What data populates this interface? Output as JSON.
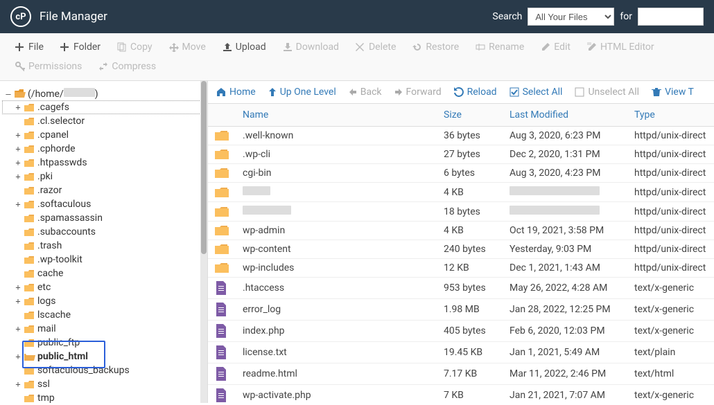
{
  "header": {
    "app_title": "File Manager",
    "search_label": "Search",
    "search_scope_selected": "All Your Files",
    "for_label": "for"
  },
  "toolbar": [
    {
      "id": "file",
      "label": "File",
      "icon": "plus",
      "disabled": false
    },
    {
      "id": "folder",
      "label": "Folder",
      "icon": "plus",
      "disabled": false
    },
    {
      "id": "copy",
      "label": "Copy",
      "icon": "copy",
      "disabled": true
    },
    {
      "id": "move",
      "label": "Move",
      "icon": "move",
      "disabled": true
    },
    {
      "id": "upload",
      "label": "Upload",
      "icon": "upload",
      "disabled": false
    },
    {
      "id": "download",
      "label": "Download",
      "icon": "download",
      "disabled": true
    },
    {
      "id": "delete",
      "label": "Delete",
      "icon": "x",
      "disabled": true
    },
    {
      "id": "restore",
      "label": "Restore",
      "icon": "restore",
      "disabled": true
    },
    {
      "id": "rename",
      "label": "Rename",
      "icon": "rename",
      "disabled": true
    },
    {
      "id": "edit",
      "label": "Edit",
      "icon": "pencil",
      "disabled": true
    },
    {
      "id": "html-editor",
      "label": "HTML Editor",
      "icon": "html",
      "disabled": true
    },
    {
      "id": "permissions",
      "label": "Permissions",
      "icon": "key",
      "disabled": true
    },
    {
      "id": "compress",
      "label": "Compress",
      "icon": "compress",
      "disabled": true
    }
  ],
  "tree": {
    "root_label": "(/home/",
    "root_label_suffix": ")",
    "items": [
      {
        "label": ".cagefs",
        "expandable": true,
        "depth": 1,
        "dotted": true
      },
      {
        "label": ".cl.selector",
        "expandable": false,
        "depth": 1
      },
      {
        "label": ".cpanel",
        "expandable": true,
        "depth": 1
      },
      {
        "label": ".cphorde",
        "expandable": true,
        "depth": 1
      },
      {
        "label": ".htpasswds",
        "expandable": true,
        "depth": 1
      },
      {
        "label": ".pki",
        "expandable": true,
        "depth": 1
      },
      {
        "label": ".razor",
        "expandable": false,
        "depth": 1
      },
      {
        "label": ".softaculous",
        "expandable": true,
        "depth": 1
      },
      {
        "label": ".spamassassin",
        "expandable": false,
        "depth": 1
      },
      {
        "label": ".subaccounts",
        "expandable": false,
        "depth": 1
      },
      {
        "label": ".trash",
        "expandable": false,
        "depth": 1
      },
      {
        "label": ".wp-toolkit",
        "expandable": false,
        "depth": 1
      },
      {
        "label": "cache",
        "expandable": false,
        "depth": 1
      },
      {
        "label": "etc",
        "expandable": true,
        "depth": 1
      },
      {
        "label": "logs",
        "expandable": true,
        "depth": 1
      },
      {
        "label": "lscache",
        "expandable": false,
        "depth": 1
      },
      {
        "label": "mail",
        "expandable": true,
        "depth": 1
      },
      {
        "label": "public_ftp",
        "expandable": false,
        "depth": 1
      },
      {
        "label": "public_html",
        "expandable": true,
        "depth": 1,
        "selected": true,
        "open": true
      },
      {
        "label": "softaculous_backups",
        "expandable": false,
        "depth": 1
      },
      {
        "label": "ssl",
        "expandable": true,
        "depth": 1
      },
      {
        "label": "tmp",
        "expandable": false,
        "depth": 1
      }
    ]
  },
  "content_toolbar": [
    {
      "id": "home",
      "label": "Home",
      "icon": "home",
      "style": "blue"
    },
    {
      "id": "up",
      "label": "Up One Level",
      "icon": "up",
      "style": "blue"
    },
    {
      "id": "back",
      "label": "Back",
      "icon": "left",
      "style": "gray"
    },
    {
      "id": "forward",
      "label": "Forward",
      "icon": "right",
      "style": "gray"
    },
    {
      "id": "reload",
      "label": "Reload",
      "icon": "reload",
      "style": "blue"
    },
    {
      "id": "select-all",
      "label": "Select All",
      "icon": "check",
      "style": "blue"
    },
    {
      "id": "unselect-all",
      "label": "Unselect All",
      "icon": "uncheck",
      "style": "gray"
    },
    {
      "id": "view-trash",
      "label": "View Trash",
      "icon": "trash",
      "style": "blue"
    }
  ],
  "table": {
    "columns": [
      "Name",
      "Size",
      "Last Modified",
      "Type"
    ],
    "rows": [
      {
        "icon": "folder",
        "name": ".well-known",
        "size": "36 bytes",
        "modified": "Aug 3, 2020, 6:23 PM",
        "type": "httpd/unix-directory"
      },
      {
        "icon": "folder",
        "name": ".wp-cli",
        "size": "27 bytes",
        "modified": "Dec 2, 2020, 1:31 PM",
        "type": "httpd/unix-directory"
      },
      {
        "icon": "folder",
        "name": "cgi-bin",
        "size": "6 bytes",
        "modified": "Aug 3, 2020, 4:23 PM",
        "type": "httpd/unix-directory"
      },
      {
        "icon": "folder",
        "name": "",
        "size": "4 KB",
        "modified": "",
        "type": "httpd/unix-directory",
        "redacted": true
      },
      {
        "icon": "folder",
        "name": "",
        "size": "18 bytes",
        "modified": "",
        "type": "httpd/unix-directory",
        "redacted": true
      },
      {
        "icon": "folder",
        "name": "wp-admin",
        "size": "4 KB",
        "modified": "Oct 19, 2021, 3:58 PM",
        "type": "httpd/unix-directory"
      },
      {
        "icon": "folder",
        "name": "wp-content",
        "size": "240 bytes",
        "modified": "Yesterday, 9:03 PM",
        "type": "httpd/unix-directory"
      },
      {
        "icon": "folder",
        "name": "wp-includes",
        "size": "12 KB",
        "modified": "Dec 1, 2021, 1:43 AM",
        "type": "httpd/unix-directory"
      },
      {
        "icon": "file",
        "name": ".htaccess",
        "size": "953 bytes",
        "modified": "May 26, 2022, 4:28 AM",
        "type": "text/x-generic"
      },
      {
        "icon": "file",
        "name": "error_log",
        "size": "1.98 MB",
        "modified": "Jan 28, 2022, 12:25 PM",
        "type": "text/x-generic"
      },
      {
        "icon": "file",
        "name": "index.php",
        "size": "405 bytes",
        "modified": "Feb 6, 2020, 12:03 PM",
        "type": "text/x-generic"
      },
      {
        "icon": "file",
        "name": "license.txt",
        "size": "19.45 KB",
        "modified": "Jan 1, 2021, 5:49 AM",
        "type": "text/plain"
      },
      {
        "icon": "file",
        "name": "readme.html",
        "size": "7.17 KB",
        "modified": "Mar 11, 2022, 2:46 PM",
        "type": "text/html"
      },
      {
        "icon": "file",
        "name": "wp-activate.php",
        "size": "7 KB",
        "modified": "Jan 21, 2021, 7:07 AM",
        "type": "text/x-generic"
      }
    ]
  }
}
